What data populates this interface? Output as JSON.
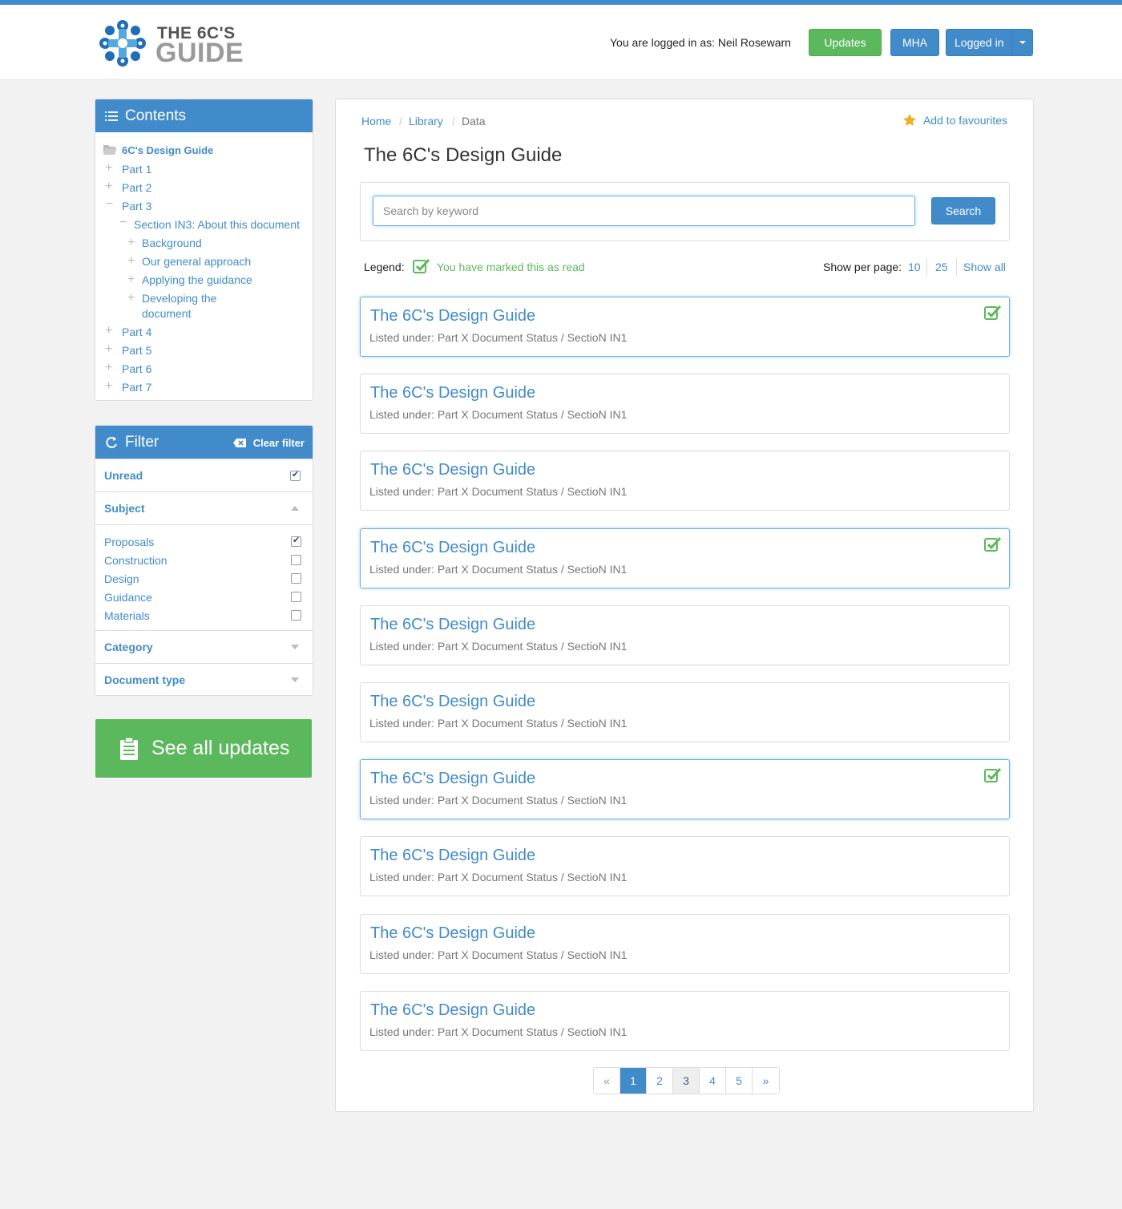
{
  "header": {
    "logo_line1": "THE 6C'S",
    "logo_line2": "GUIDE",
    "user_text": "You are logged in as: Neil Rosewarn",
    "updates_label": "Updates",
    "mha_label": "MHA",
    "logged_in_label": "Logged in"
  },
  "contents": {
    "title": "Contents",
    "root": "6C's Design Guide",
    "parts": [
      "Part 1",
      "Part 2",
      "Part 3",
      "Part 4",
      "Part 5",
      "Part 6",
      "Part 7"
    ],
    "section": "Section IN3: About this document",
    "subsections": [
      "Background",
      "Our general approach",
      "Applying the guidance",
      "Developing the",
      "document"
    ]
  },
  "filter": {
    "title": "Filter",
    "clear_label": "Clear filter",
    "unread_label": "Unread",
    "unread_checked": true,
    "subject_label": "Subject",
    "subjects": [
      {
        "label": "Proposals",
        "checked": true
      },
      {
        "label": "Construction",
        "checked": false
      },
      {
        "label": "Design",
        "checked": false
      },
      {
        "label": "Guidance",
        "checked": false
      },
      {
        "label": "Materials",
        "checked": false
      }
    ],
    "category_label": "Category",
    "doctype_label": "Document type"
  },
  "see_updates_label": "See all updates",
  "breadcrumb": {
    "home": "Home",
    "library": "Library",
    "current": "Data"
  },
  "favourites_label": "Add to favourites",
  "page_title": "The 6C's Design Guide",
  "search": {
    "placeholder": "Search by keyword",
    "button_label": "Search"
  },
  "legend": {
    "label": "Legend:",
    "text": "You have marked this as read"
  },
  "per_page": {
    "label": "Show per page:",
    "opt10": "10",
    "opt25": "25",
    "all": "Show all"
  },
  "results": [
    {
      "title": "The 6C's Design Guide",
      "sub": "Listed under: Part X Document Status / SectioN  IN1",
      "read": true
    },
    {
      "title": "The 6C's Design Guide",
      "sub": "Listed under: Part X Document Status / SectioN  IN1",
      "read": false
    },
    {
      "title": "The 6C's Design Guide",
      "sub": "Listed under: Part X Document Status / SectioN  IN1",
      "read": false
    },
    {
      "title": "The 6C's Design Guide",
      "sub": "Listed under: Part X Document Status / SectioN  IN1",
      "read": true
    },
    {
      "title": "The 6C's Design Guide",
      "sub": "Listed under: Part X Document Status / SectioN  IN1",
      "read": false
    },
    {
      "title": "The 6C's Design Guide",
      "sub": "Listed under: Part X Document Status / SectioN  IN1",
      "read": false
    },
    {
      "title": "The 6C's Design Guide",
      "sub": "Listed under: Part X Document Status / SectioN  IN1",
      "read": true
    },
    {
      "title": "The 6C's Design Guide",
      "sub": "Listed under: Part X Document Status / SectioN  IN1",
      "read": false
    },
    {
      "title": "The 6C's Design Guide",
      "sub": "Listed under: Part X Document Status / SectioN  IN1",
      "read": false
    },
    {
      "title": "The 6C's Design Guide",
      "sub": "Listed under: Part X Document Status / SectioN  IN1",
      "read": false
    }
  ],
  "pagination": {
    "prev": "«",
    "pages": [
      "1",
      "2",
      "3",
      "4",
      "5"
    ],
    "next": "»",
    "current": "1"
  },
  "colors": {
    "brand_blue": "#428bca",
    "success_green": "#5cb85c",
    "star": "#f0ad1e"
  }
}
